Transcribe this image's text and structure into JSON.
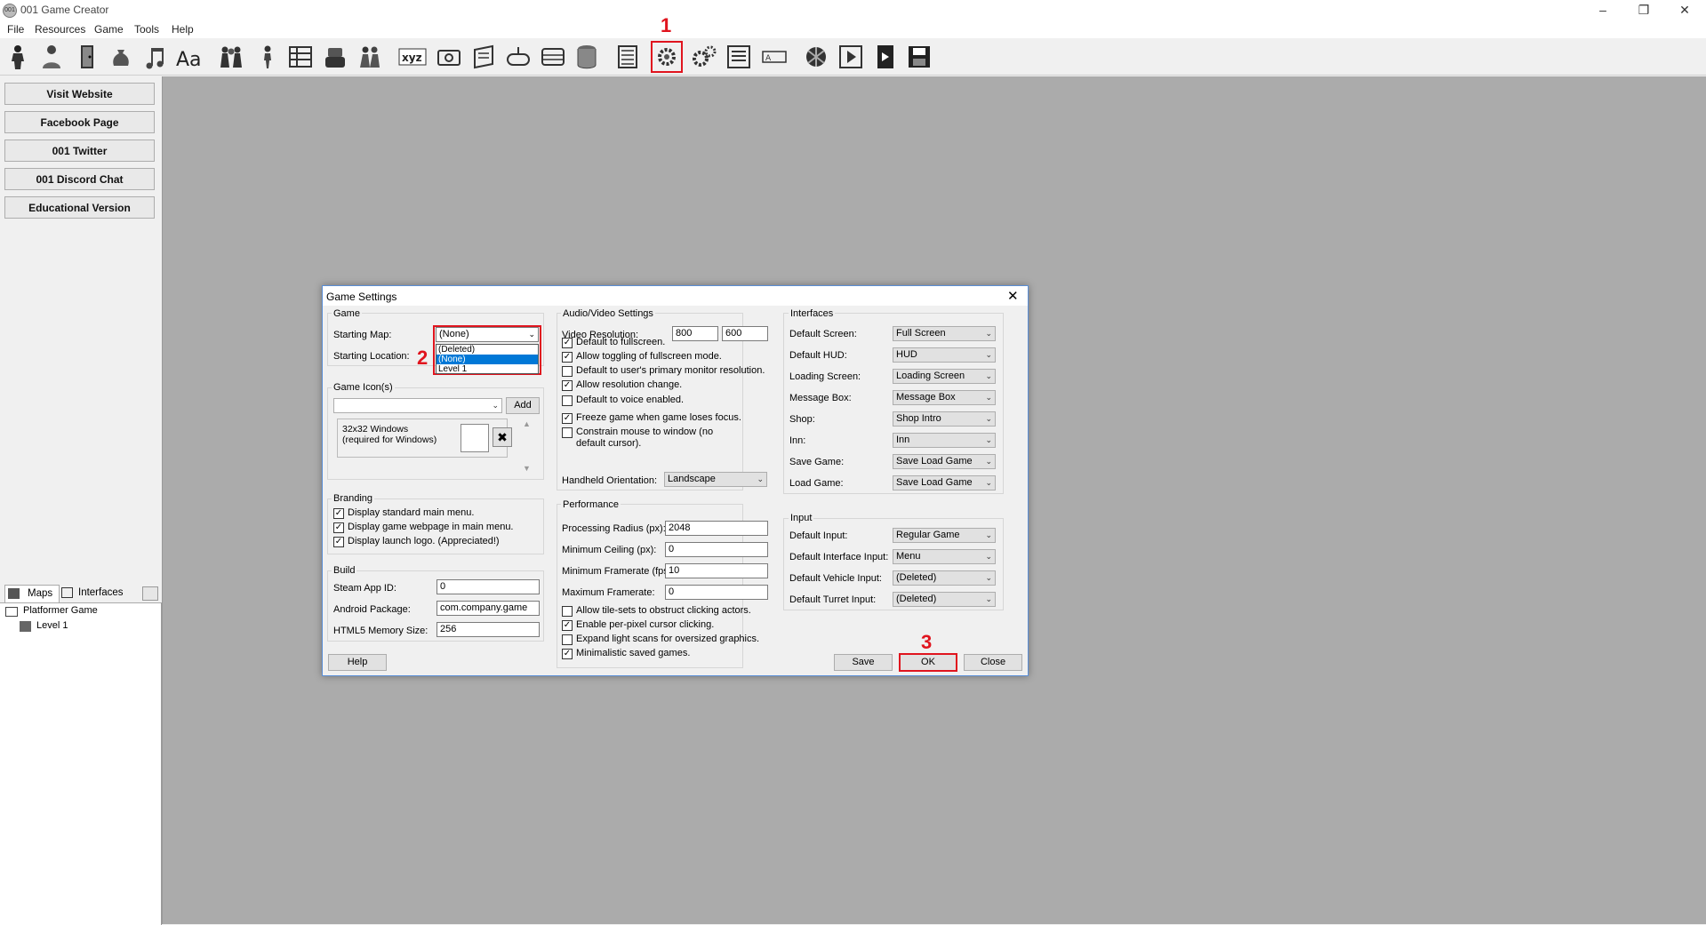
{
  "window": {
    "title": "001 Game Creator",
    "app_icon_text": "001"
  },
  "menu": [
    "File",
    "Resources",
    "Game",
    "Tools",
    "Help"
  ],
  "toolbar_icons": [
    "actor-icon",
    "player-icon",
    "door-icon",
    "item-bag-icon",
    "music-icon",
    "font-icon",
    "group-icon",
    "character-icon",
    "list-grid-icon",
    "robot-icon",
    "party-icon",
    "xyz-variable-icon",
    "camera-icon",
    "script-icon",
    "gamepad-icon",
    "database-table-icon",
    "database-icon",
    "list-icon",
    "gear-settings-icon",
    "gears-icon",
    "text-list-icon",
    "label-box-icon",
    "globe-icon",
    "play-video-icon",
    "film-icon",
    "save-disk-icon"
  ],
  "left_buttons": [
    "Visit Website",
    "Facebook Page",
    "001 Twitter",
    "001 Discord Chat",
    "Educational Version"
  ],
  "panel_tabs": {
    "maps": "Maps",
    "interfaces": "Interfaces"
  },
  "tree": {
    "root": "Platformer Game",
    "child": "Level 1"
  },
  "dialog": {
    "title": "Game Settings",
    "game": {
      "label": "Game",
      "starting_map_label": "Starting Map:",
      "starting_map_value": "(None)",
      "starting_location_label": "Starting Location:",
      "dropdown_options": [
        "(Deleted)",
        "(None)",
        "Level 1"
      ]
    },
    "icons": {
      "label": "Game Icon(s)",
      "add": "Add",
      "item": "32x32 Windows (required for Windows)"
    },
    "branding": {
      "label": "Branding",
      "items": [
        {
          "text": "Display standard main menu.",
          "checked": true
        },
        {
          "text": "Display game webpage in main menu.",
          "checked": true
        },
        {
          "text": "Display launch logo. (Appreciated!)",
          "checked": true
        }
      ]
    },
    "build": {
      "label": "Build",
      "steam_label": "Steam App ID:",
      "steam_value": "0",
      "android_label": "Android Package:",
      "android_value": "com.company.game",
      "html5_label": "HTML5 Memory Size:",
      "html5_value": "256"
    },
    "av": {
      "label": "Audio/Video Settings",
      "res_label": "Video Resolution:",
      "res_w": "800",
      "res_h": "600",
      "checks": [
        {
          "text": "Default to fullscreen.",
          "checked": true
        },
        {
          "text": "Allow toggling of fullscreen mode.",
          "checked": true
        },
        {
          "text": "Default to user's primary monitor resolution.",
          "checked": false
        },
        {
          "text": "Allow resolution change.",
          "checked": true
        },
        {
          "text": "Default to voice enabled.",
          "checked": false
        },
        {
          "text": "Freeze game when game loses focus.",
          "checked": true
        },
        {
          "text": "Constrain mouse to window (no default cursor).",
          "checked": false
        }
      ],
      "orientation_label": "Handheld Orientation:",
      "orientation_value": "Landscape"
    },
    "perf": {
      "label": "Performance",
      "fields": [
        {
          "label": "Processing Radius (px):",
          "value": "2048"
        },
        {
          "label": "Minimum Ceiling (px):",
          "value": "0"
        },
        {
          "label": "Minimum Framerate (fps):",
          "value": "10"
        },
        {
          "label": "Maximum Framerate:",
          "value": "0"
        }
      ],
      "checks": [
        {
          "text": "Allow tile-sets to obstruct clicking actors.",
          "checked": false
        },
        {
          "text": "Enable per-pixel cursor clicking.",
          "checked": true
        },
        {
          "text": "Expand light scans for oversized graphics.",
          "checked": false
        },
        {
          "text": "Minimalistic saved games.",
          "checked": true
        }
      ]
    },
    "interfaces": {
      "label": "Interfaces",
      "rows": [
        {
          "label": "Default Screen:",
          "value": "Full Screen"
        },
        {
          "label": "Default HUD:",
          "value": "HUD"
        },
        {
          "label": "Loading Screen:",
          "value": "Loading Screen"
        },
        {
          "label": "Message Box:",
          "value": "Message Box"
        },
        {
          "label": "Shop:",
          "value": "Shop Intro"
        },
        {
          "label": "Inn:",
          "value": "Inn"
        },
        {
          "label": "Save Game:",
          "value": "Save Load Game"
        },
        {
          "label": "Load Game:",
          "value": "Save Load Game"
        }
      ]
    },
    "input": {
      "label": "Input",
      "rows": [
        {
          "label": "Default Input:",
          "value": "Regular Game"
        },
        {
          "label": "Default Interface Input:",
          "value": "Menu"
        },
        {
          "label": "Default Vehicle Input:",
          "value": "(Deleted)"
        },
        {
          "label": "Default Turret Input:",
          "value": "(Deleted)"
        }
      ]
    },
    "buttons": {
      "help": "Help",
      "save": "Save",
      "ok": "OK",
      "close": "Close"
    }
  },
  "annotations": [
    "1",
    "2",
    "3"
  ],
  "colors": {
    "annotation_red": "#e0141e",
    "workspace": "#ababab",
    "selection": "#0078d7"
  }
}
